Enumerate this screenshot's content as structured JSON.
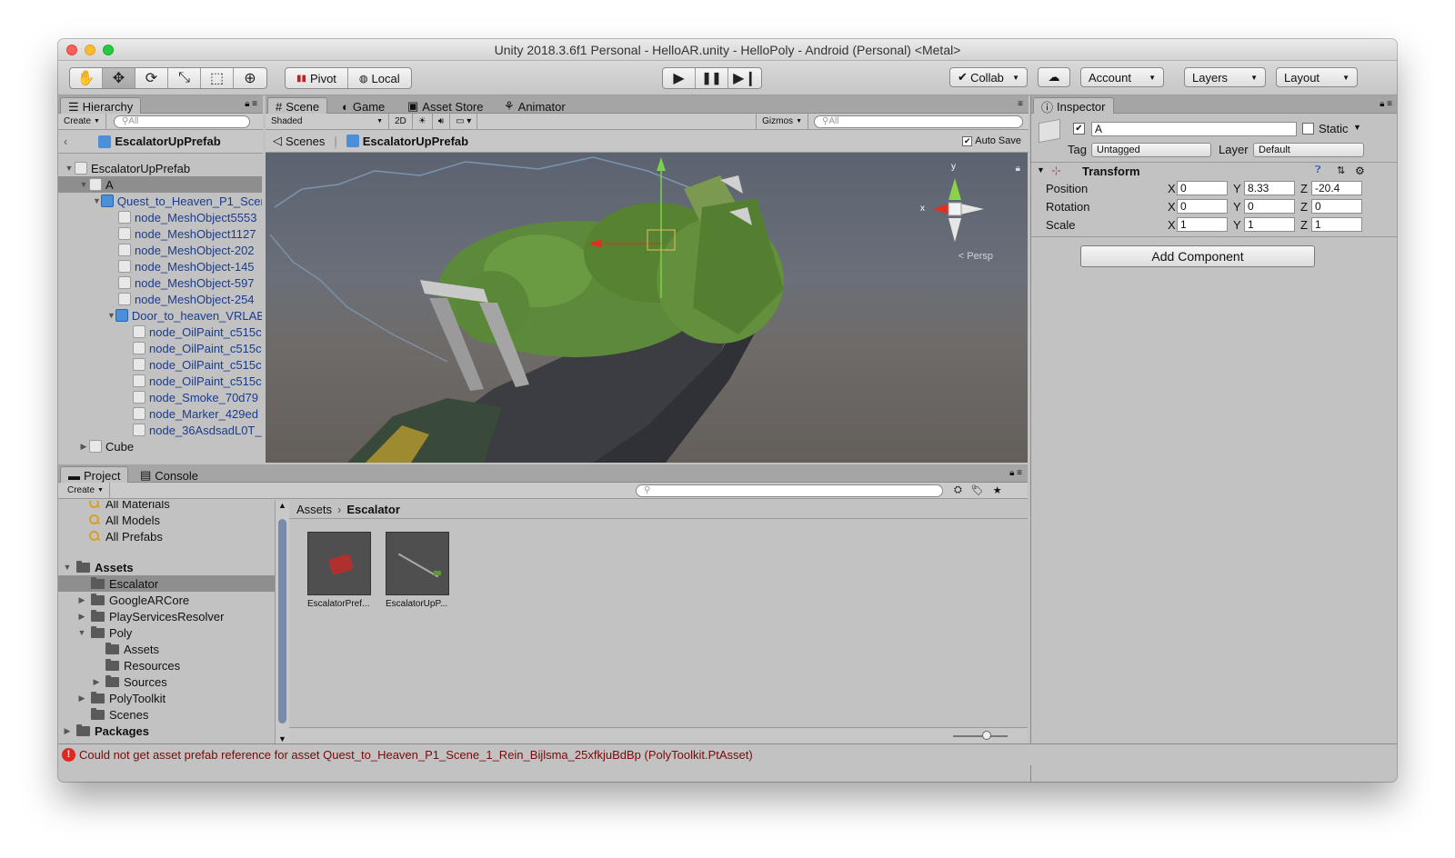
{
  "window": {
    "title": "Unity 2018.3.6f1 Personal - HelloAR.unity - HelloPoly - Android (Personal) <Metal>"
  },
  "toolbar": {
    "pivot_label": "Pivot",
    "local_label": "Local",
    "collab_label": "Collab",
    "account_label": "Account",
    "layers_label": "Layers",
    "layout_label": "Layout"
  },
  "hierarchy": {
    "tab_label": "Hierarchy",
    "create_label": "Create",
    "search_placeholder": "All",
    "prefab_breadcrumb": "EscalatorUpPrefab",
    "rows": [
      {
        "label": "EscalatorUpPrefab",
        "indent": 0,
        "arrow": "▼"
      },
      {
        "label": "A",
        "indent": 1,
        "arrow": "▼"
      },
      {
        "label": "Quest_to_Heaven_P1_Scen",
        "indent": 2,
        "arrow": "▼"
      },
      {
        "label": "node_MeshObject5553",
        "indent": 3,
        "arrow": ""
      },
      {
        "label": "node_MeshObject1127",
        "indent": 3,
        "arrow": ""
      },
      {
        "label": "node_MeshObject-202",
        "indent": 3,
        "arrow": ""
      },
      {
        "label": "node_MeshObject-145",
        "indent": 3,
        "arrow": ""
      },
      {
        "label": "node_MeshObject-597",
        "indent": 3,
        "arrow": ""
      },
      {
        "label": "node_MeshObject-254",
        "indent": 3,
        "arrow": ""
      },
      {
        "label": "Door_to_heaven_VRLAB",
        "indent": 3,
        "arrow": "▼"
      },
      {
        "label": "node_OilPaint_c515c",
        "indent": 4,
        "arrow": ""
      },
      {
        "label": "node_OilPaint_c515c",
        "indent": 4,
        "arrow": ""
      },
      {
        "label": "node_OilPaint_c515c",
        "indent": 4,
        "arrow": ""
      },
      {
        "label": "node_OilPaint_c515c",
        "indent": 4,
        "arrow": ""
      },
      {
        "label": "node_Smoke_70d79",
        "indent": 4,
        "arrow": ""
      },
      {
        "label": "node_Marker_429ed",
        "indent": 4,
        "arrow": ""
      },
      {
        "label": "node_36AsdsadL0T_",
        "indent": 4,
        "arrow": ""
      },
      {
        "label": "Cube",
        "indent": 1,
        "arrow": "▶"
      }
    ]
  },
  "scene": {
    "tabs": [
      "Scene",
      "Game",
      "Asset Store",
      "Animator"
    ],
    "shading_mode": "Shaded",
    "mode_2d": "2D",
    "gizmos_label": "Gizmos",
    "search_placeholder": "All",
    "scenes_label": "Scenes",
    "prefab_label": "EscalatorUpPrefab",
    "auto_save_label": "Auto Save",
    "persp_label": "< Persp",
    "axis_x": "x",
    "axis_y": "y"
  },
  "inspector": {
    "tab_label": "Inspector",
    "object_name": "A",
    "static_label": "Static",
    "tag_label": "Tag",
    "tag_value": "Untagged",
    "layer_label": "Layer",
    "layer_value": "Default",
    "transform_label": "Transform",
    "position_label": "Position",
    "rotation_label": "Rotation",
    "scale_label": "Scale",
    "axis_labels": [
      "X",
      "Y",
      "Z"
    ],
    "position": [
      "0",
      "8.33",
      "-20.4"
    ],
    "rotation": [
      "0",
      "0",
      "0"
    ],
    "scale": [
      "1",
      "1",
      "1"
    ],
    "add_component_label": "Add Component"
  },
  "project": {
    "tabs": [
      "Project",
      "Console"
    ],
    "create_label": "Create",
    "favorites": [
      "All Materials",
      "All Models",
      "All Prefabs"
    ],
    "tree": [
      {
        "label": "Assets",
        "indent": 0,
        "arrow": "▼",
        "bold": true
      },
      {
        "label": "Escalator",
        "indent": 1,
        "arrow": "",
        "selected": true
      },
      {
        "label": "GoogleARCore",
        "indent": 1,
        "arrow": "▶"
      },
      {
        "label": "PlayServicesResolver",
        "indent": 1,
        "arrow": "▶"
      },
      {
        "label": "Poly",
        "indent": 1,
        "arrow": "▼"
      },
      {
        "label": "Assets",
        "indent": 2,
        "arrow": ""
      },
      {
        "label": "Resources",
        "indent": 2,
        "arrow": ""
      },
      {
        "label": "Sources",
        "indent": 2,
        "arrow": "▶"
      },
      {
        "label": "PolyToolkit",
        "indent": 1,
        "arrow": "▶"
      },
      {
        "label": "Scenes",
        "indent": 1,
        "arrow": ""
      },
      {
        "label": "Packages",
        "indent": 0,
        "arrow": "▶",
        "bold": true
      }
    ],
    "breadcrumb_root": "Assets",
    "breadcrumb_current": "Escalator",
    "assets": [
      "EscalatorPref...",
      "EscalatorUpP..."
    ]
  },
  "status": {
    "message": "Could not get asset prefab reference for asset Quest_to_Heaven_P1_Scene_1_Rein_Bijlsma_25xfkjuBdBp (PolyToolkit.PtAsset)",
    "icon_color": "#e0281e"
  }
}
